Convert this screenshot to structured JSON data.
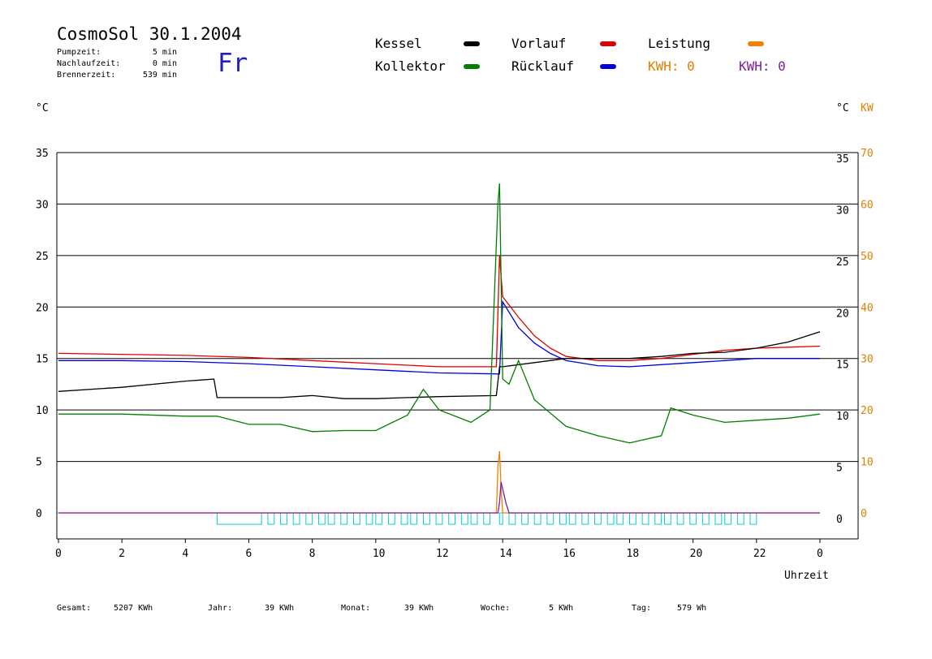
{
  "header": {
    "title": "CosmoSol 30.1.2004",
    "day": "Fr",
    "stats": [
      {
        "label": "Pumpzeit:",
        "value": "5 min"
      },
      {
        "label": "Nachlaufzeit:",
        "value": "0 min"
      },
      {
        "label": "Brennerzeit:",
        "value": "539 min"
      }
    ]
  },
  "legend": {
    "kessel": "Kessel",
    "kollektor": "Kollektor",
    "vorlauf": "Vorlauf",
    "ruecklauf": "Rücklauf",
    "leistung": "Leistung",
    "kwh1": "KWH: 0",
    "kwh2": "KWH: 0"
  },
  "colors": {
    "kessel": "#000000",
    "kollektor": "#007f00",
    "vorlauf": "#e00000",
    "ruecklauf": "#0000e0",
    "leistung": "#f08000",
    "kwh2": "#7f1f9f",
    "pump": "#00d0d0"
  },
  "axes": {
    "left_unit": "°C",
    "right_unit": "°C",
    "right_unit2": "KW",
    "xlabel": "Uhrzeit"
  },
  "footer": [
    {
      "label": "Gesamt:",
      "value": "5207 KWh"
    },
    {
      "label": "Jahr:",
      "value": "39 KWh"
    },
    {
      "label": "Monat:",
      "value": "39 KWh"
    },
    {
      "label": "Woche:",
      "value": "5 KWh"
    },
    {
      "label": "Tag:",
      "value": "579 Wh"
    }
  ],
  "chart_data": {
    "type": "line",
    "xlabel": "Uhrzeit",
    "ylabel": "°C",
    "y2label": "KW",
    "xlim": [
      0,
      24
    ],
    "ylim": [
      0,
      35
    ],
    "y2lim": [
      0,
      70
    ],
    "grid": true,
    "x_ticks": [
      0,
      2,
      4,
      6,
      8,
      10,
      12,
      14,
      16,
      18,
      20,
      22,
      24
    ],
    "x_tick_labels": [
      "0",
      "2",
      "4",
      "6",
      "8",
      "10",
      "12",
      "14",
      "16",
      "18",
      "20",
      "22",
      "0"
    ],
    "y_ticks": [
      0,
      5,
      10,
      15,
      20,
      25,
      30,
      35
    ],
    "y2_ticks": [
      0,
      10,
      20,
      30,
      40,
      50,
      60,
      70
    ],
    "series": [
      {
        "name": "Vorlauf",
        "key": "vorlauf",
        "x": [
          0,
          2,
          4,
          6,
          8,
          10,
          12,
          13.8,
          13.9,
          14.0,
          14.5,
          15,
          15.5,
          16,
          17,
          18,
          19,
          20,
          21,
          22,
          23,
          24
        ],
        "y": [
          15.5,
          15.4,
          15.3,
          15.1,
          14.8,
          14.5,
          14.2,
          14.2,
          25.0,
          21.0,
          19.0,
          17.2,
          16.0,
          15.2,
          14.8,
          14.8,
          15.0,
          15.4,
          15.8,
          16.0,
          16.1,
          16.2
        ]
      },
      {
        "name": "Rücklauf",
        "key": "ruecklauf",
        "x": [
          0,
          2,
          4,
          6,
          8,
          10,
          12,
          13.8,
          13.9,
          14.0,
          14.5,
          15,
          15.5,
          16,
          17,
          18,
          19,
          20,
          21,
          22,
          23,
          24
        ],
        "y": [
          14.8,
          14.8,
          14.7,
          14.5,
          14.2,
          13.9,
          13.6,
          13.5,
          13.5,
          20.5,
          18.0,
          16.5,
          15.5,
          14.8,
          14.3,
          14.2,
          14.4,
          14.6,
          14.8,
          15.0,
          15.0,
          15.0
        ]
      },
      {
        "name": "Kessel",
        "key": "kessel",
        "x": [
          0,
          2,
          4,
          4.9,
          5,
          6,
          7,
          8,
          9,
          10,
          11,
          12,
          13.8,
          13.9,
          14,
          15,
          16,
          17,
          18,
          19,
          20,
          21,
          22,
          23,
          24
        ],
        "y": [
          11.8,
          12.2,
          12.8,
          13.0,
          11.2,
          11.2,
          11.2,
          11.4,
          11.1,
          11.1,
          11.2,
          11.3,
          11.4,
          14.2,
          14.2,
          14.6,
          15.0,
          15.0,
          15.0,
          15.2,
          15.5,
          15.6,
          16.0,
          16.6,
          17.6
        ]
      },
      {
        "name": "Kollektor",
        "key": "kollektor",
        "x": [
          0,
          2,
          4,
          5,
          6,
          7,
          8,
          9,
          10,
          11,
          11.5,
          12,
          13,
          13.6,
          13.85,
          13.9,
          14.0,
          14.2,
          14.5,
          15,
          16,
          17,
          18,
          19,
          19.3,
          20,
          21,
          22,
          23,
          24
        ],
        "y": [
          9.6,
          9.6,
          9.4,
          9.4,
          8.6,
          8.6,
          7.9,
          8.0,
          8.0,
          9.5,
          12.0,
          10.0,
          8.8,
          10.0,
          30.0,
          32.0,
          13.0,
          12.5,
          14.8,
          11.0,
          8.4,
          7.5,
          6.8,
          7.5,
          10.2,
          9.5,
          8.8,
          9.0,
          9.2,
          9.6
        ]
      },
      {
        "name": "Leistung",
        "key": "leistung",
        "axis": "y2",
        "x": [
          0,
          13.8,
          13.85,
          13.9,
          13.95,
          14.0,
          24
        ],
        "y": [
          0,
          0,
          9,
          12,
          5,
          0,
          0
        ]
      },
      {
        "name": "KWH",
        "key": "kwh2",
        "axis": "y2",
        "x": [
          0,
          13.85,
          13.9,
          13.95,
          14.1,
          14.2,
          24
        ],
        "y": [
          0,
          0,
          2,
          6,
          2,
          0,
          0
        ]
      }
    ],
    "pump_pulses": [
      [
        5,
        6.4
      ],
      [
        6.6,
        6.8
      ],
      [
        7.0,
        7.2
      ],
      [
        7.4,
        7.6
      ],
      [
        7.8,
        8.0
      ],
      [
        8.2,
        8.4
      ],
      [
        8.5,
        8.7
      ],
      [
        8.9,
        9.1
      ],
      [
        9.3,
        9.5
      ],
      [
        9.7,
        9.9
      ],
      [
        10.0,
        10.2
      ],
      [
        10.4,
        10.6
      ],
      [
        10.8,
        11.0
      ],
      [
        11.1,
        11.3
      ],
      [
        11.5,
        11.7
      ],
      [
        11.9,
        12.1
      ],
      [
        12.3,
        12.5
      ],
      [
        12.7,
        12.9
      ],
      [
        13.0,
        13.2
      ],
      [
        13.4,
        13.6
      ],
      [
        13.9,
        14.0
      ],
      [
        14.2,
        14.4
      ],
      [
        14.6,
        14.8
      ],
      [
        15.0,
        15.2
      ],
      [
        15.4,
        15.6
      ],
      [
        15.8,
        16.0
      ],
      [
        16.1,
        16.3
      ],
      [
        16.5,
        16.7
      ],
      [
        16.9,
        17.1
      ],
      [
        17.3,
        17.5
      ],
      [
        17.6,
        17.8
      ],
      [
        18.0,
        18.2
      ],
      [
        18.4,
        18.6
      ],
      [
        18.8,
        19.0
      ],
      [
        19.1,
        19.3
      ],
      [
        19.5,
        19.7
      ],
      [
        19.9,
        20.1
      ],
      [
        20.3,
        20.5
      ],
      [
        20.7,
        20.9
      ],
      [
        21.0,
        21.2
      ],
      [
        21.4,
        21.6
      ],
      [
        21.8,
        22.0
      ]
    ]
  }
}
